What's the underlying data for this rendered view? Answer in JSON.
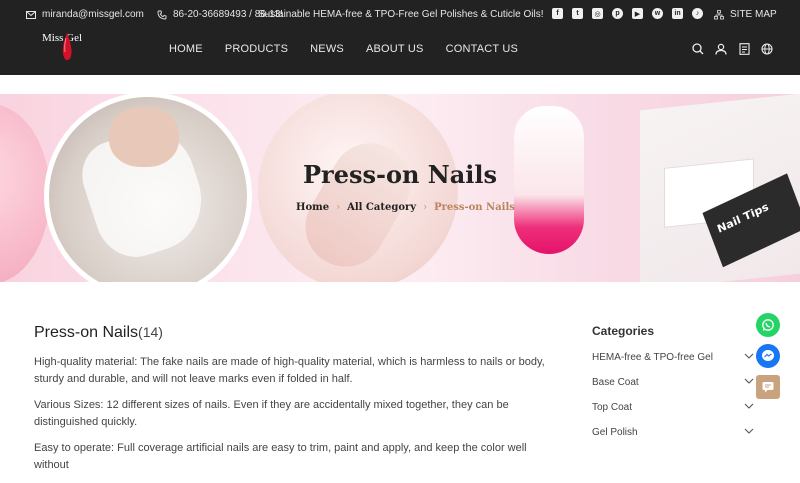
{
  "topbar": {
    "email": "miranda@missgel.com",
    "phone": "86-20-36689493 / 86-13570432452",
    "promo": "Sustainable HEMA-free & TPO-Free Gel Polishes & Cuticle Oils!",
    "social": [
      "facebook-icon",
      "twitter-icon",
      "instagram-icon",
      "pinterest-icon",
      "youtube-icon",
      "whatsapp-icon",
      "linkedin-icon",
      "tiktok-icon"
    ],
    "sitemap": "SITE MAP"
  },
  "logo": {
    "text": "Miss Gel"
  },
  "nav": {
    "items": [
      "HOME",
      "PRODUCTS",
      "NEWS",
      "ABOUT US",
      "CONTACT US"
    ]
  },
  "banner": {
    "title": "Press-on Nails",
    "breadcrumb": [
      "Home",
      "All Category",
      "Press-on Nails"
    ],
    "box_text": "Nail Tips"
  },
  "main": {
    "title": "Press-on Nails",
    "count": "(14)",
    "paragraphs": [
      "High-quality material: The fake nails are made of high-quality material, which is harmless to nails or body, sturdy and durable, and will not leave marks even if folded in half.",
      "Various Sizes: 12 different sizes of nails. Even if they are accidentally mixed together, they can be distinguished quickly.",
      "Easy to operate: Full coverage artificial nails are easy to trim, paint and apply, and keep the color well without"
    ]
  },
  "sidebar": {
    "title": "Categories",
    "items": [
      "HEMA-free & TPO-free Gel",
      "Base Coat",
      "Top Coat",
      "Gel Polish"
    ]
  },
  "colors": {
    "header": "#222222",
    "accent": "#b8845e",
    "whatsapp": "#25d366",
    "messenger": "#1877f2",
    "chat": "#c9a27e"
  }
}
